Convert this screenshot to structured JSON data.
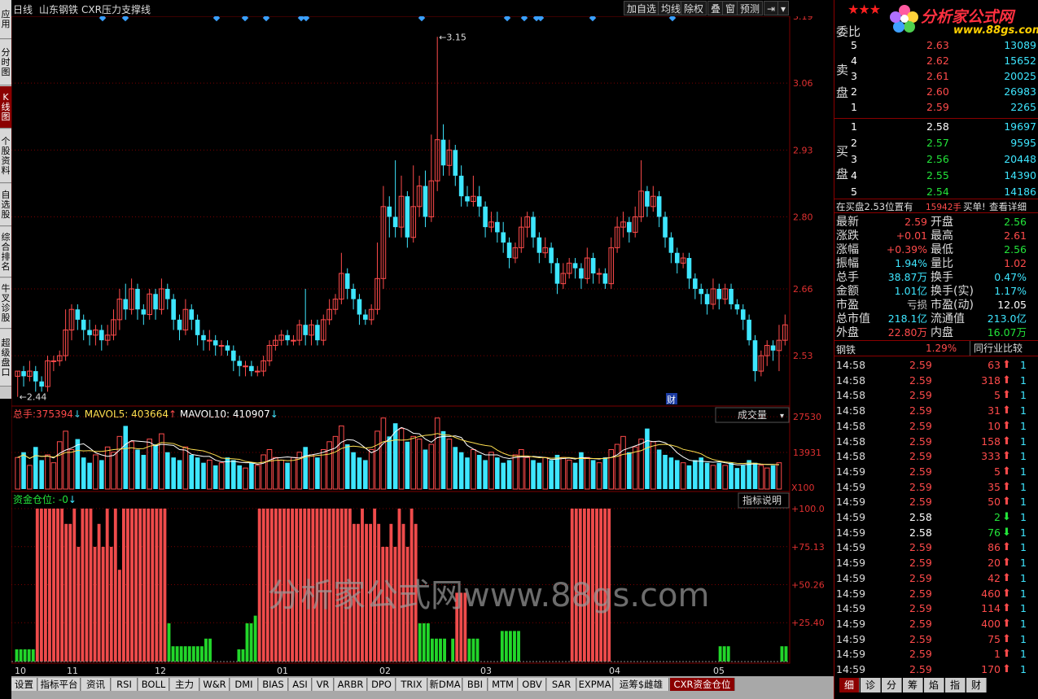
{
  "left_tabs": [
    "应用",
    "分时图",
    "K线图",
    "个股资料",
    "自选股",
    "综合排名",
    "牛叉诊股",
    "超级盘口"
  ],
  "top": {
    "period": "日线",
    "stock": "山东钢铁",
    "indicator": "CXR压力支撑线",
    "buttons": [
      "加自选",
      "均线",
      "除权",
      "叠",
      "窗",
      "预测"
    ],
    "nav_icon": "⇥",
    "menu_icon": "▾"
  },
  "price_axis": [
    "3.19",
    "3.06",
    "2.93",
    "2.80",
    "2.66",
    "2.53"
  ],
  "markers": {
    "high": "3.15",
    "low": "2.44",
    "fin": "财"
  },
  "vol": {
    "total_label": "总手:",
    "total": "375394",
    "ma5_label": "MAVOL5:",
    "ma5": "403664",
    "ma10_label": "MAVOL10:",
    "ma10": "410907",
    "dropdown": "成交量",
    "axis": [
      "27530",
      "13931"
    ],
    "unit": "X100"
  },
  "ind": {
    "label": "资金仓位:",
    "value": "-0",
    "help": "指标说明",
    "axis": [
      "+100.0",
      "+75.13",
      "+50.26",
      "+25.40"
    ]
  },
  "date_axis": [
    "10",
    "11",
    "12",
    "01",
    "02",
    "03",
    "04",
    "05"
  ],
  "watermark": "分析家公式网www.88gs.com",
  "bottom_tabs": [
    "设置",
    "指标平台",
    "资讯",
    "RSI",
    "BOLL",
    "主力",
    "W&R",
    "DMI",
    "BIAS",
    "ASI",
    "VR",
    "ARBR",
    "DPO",
    "TRIX",
    "新DMA",
    "BBI",
    "MTM",
    "OBV",
    "SAR",
    "EXPMA",
    "运筹$雌雄",
    "CXR资金仓位"
  ],
  "colors": {
    "up": "#ff4b4b",
    "down": "#3ee6ff",
    "fund_up": "#ef4b4b",
    "fund_down": "#22d62a",
    "grid": "#7a0000"
  },
  "chart_data": {
    "type": "candlestick",
    "candles": [
      [
        2.49,
        2.5,
        2.45,
        2.5
      ],
      [
        2.5,
        2.49,
        2.47,
        2.51
      ],
      [
        2.49,
        2.5,
        2.48,
        2.52
      ],
      [
        2.5,
        2.48,
        2.46,
        2.51
      ],
      [
        2.48,
        2.47,
        2.46,
        2.49
      ],
      [
        2.47,
        2.52,
        2.46,
        2.53
      ],
      [
        2.52,
        2.52,
        2.5,
        2.53
      ],
      [
        2.52,
        2.53,
        2.51,
        2.54
      ],
      [
        2.53,
        2.58,
        2.52,
        2.62
      ],
      [
        2.58,
        2.62,
        2.56,
        2.63
      ],
      [
        2.62,
        2.6,
        2.58,
        2.63
      ],
      [
        2.6,
        2.58,
        2.56,
        2.61
      ],
      [
        2.58,
        2.57,
        2.55,
        2.6
      ],
      [
        2.57,
        2.58,
        2.55,
        2.59
      ],
      [
        2.58,
        2.56,
        2.54,
        2.59
      ],
      [
        2.56,
        2.57,
        2.55,
        2.59
      ],
      [
        2.57,
        2.6,
        2.56,
        2.62
      ],
      [
        2.6,
        2.64,
        2.58,
        2.66
      ],
      [
        2.64,
        2.62,
        2.6,
        2.67
      ],
      [
        2.62,
        2.66,
        2.61,
        2.68
      ],
      [
        2.66,
        2.62,
        2.6,
        2.67
      ],
      [
        2.62,
        2.61,
        2.59,
        2.63
      ],
      [
        2.61,
        2.65,
        2.6,
        2.66
      ],
      [
        2.65,
        2.62,
        2.6,
        2.66
      ],
      [
        2.62,
        2.66,
        2.61,
        2.68
      ],
      [
        2.66,
        2.64,
        2.62,
        2.67
      ],
      [
        2.64,
        2.6,
        2.58,
        2.65
      ],
      [
        2.6,
        2.58,
        2.56,
        2.61
      ],
      [
        2.58,
        2.62,
        2.57,
        2.64
      ],
      [
        2.62,
        2.6,
        2.58,
        2.63
      ],
      [
        2.6,
        2.57,
        2.55,
        2.61
      ],
      [
        2.57,
        2.56,
        2.54,
        2.58
      ],
      [
        2.56,
        2.56,
        2.54,
        2.58
      ],
      [
        2.56,
        2.55,
        2.53,
        2.57
      ],
      [
        2.55,
        2.55,
        2.53,
        2.56
      ],
      [
        2.55,
        2.54,
        2.53,
        2.56
      ],
      [
        2.54,
        2.52,
        2.5,
        2.55
      ],
      [
        2.52,
        2.51,
        2.49,
        2.53
      ],
      [
        2.51,
        2.51,
        2.49,
        2.52
      ],
      [
        2.51,
        2.5,
        2.49,
        2.52
      ],
      [
        2.5,
        2.5,
        2.49,
        2.51
      ],
      [
        2.5,
        2.52,
        2.49,
        2.53
      ],
      [
        2.52,
        2.55,
        2.51,
        2.56
      ],
      [
        2.55,
        2.56,
        2.54,
        2.57
      ],
      [
        2.56,
        2.57,
        2.55,
        2.58
      ],
      [
        2.57,
        2.56,
        2.55,
        2.58
      ],
      [
        2.56,
        2.56,
        2.55,
        2.57
      ],
      [
        2.56,
        2.59,
        2.55,
        2.6
      ],
      [
        2.59,
        2.57,
        2.55,
        2.66
      ],
      [
        2.57,
        2.59,
        2.55,
        2.6
      ],
      [
        2.59,
        2.56,
        2.55,
        2.6
      ],
      [
        2.56,
        2.6,
        2.55,
        2.61
      ],
      [
        2.6,
        2.62,
        2.59,
        2.64
      ],
      [
        2.62,
        2.64,
        2.61,
        2.65
      ],
      [
        2.64,
        2.69,
        2.63,
        2.73
      ],
      [
        2.69,
        2.66,
        2.64,
        2.7
      ],
      [
        2.66,
        2.64,
        2.62,
        2.67
      ],
      [
        2.64,
        2.61,
        2.59,
        2.65
      ],
      [
        2.61,
        2.6,
        2.59,
        2.62
      ],
      [
        2.6,
        2.62,
        2.59,
        2.63
      ],
      [
        2.62,
        2.68,
        2.61,
        2.75
      ],
      [
        2.68,
        2.82,
        2.66,
        2.86
      ],
      [
        2.82,
        2.8,
        2.76,
        2.84
      ],
      [
        2.8,
        2.78,
        2.76,
        2.91
      ],
      [
        2.78,
        2.84,
        2.76,
        2.88
      ],
      [
        2.84,
        2.76,
        2.74,
        2.85
      ],
      [
        2.76,
        2.82,
        2.75,
        2.9
      ],
      [
        2.82,
        2.86,
        2.8,
        2.88
      ],
      [
        2.86,
        2.8,
        2.78,
        2.89
      ],
      [
        2.8,
        2.87,
        2.79,
        2.96
      ],
      [
        2.87,
        2.95,
        2.85,
        3.15
      ],
      [
        2.95,
        2.9,
        2.88,
        2.98
      ],
      [
        2.9,
        2.93,
        2.88,
        2.95
      ],
      [
        2.93,
        2.88,
        2.86,
        2.94
      ],
      [
        2.88,
        2.84,
        2.82,
        2.9
      ],
      [
        2.84,
        2.83,
        2.82,
        2.86
      ],
      [
        2.83,
        2.84,
        2.82,
        2.88
      ],
      [
        2.84,
        2.82,
        2.8,
        2.86
      ],
      [
        2.82,
        2.78,
        2.76,
        2.83
      ],
      [
        2.78,
        2.79,
        2.77,
        2.81
      ],
      [
        2.79,
        2.77,
        2.75,
        2.81
      ],
      [
        2.77,
        2.75,
        2.73,
        2.79
      ],
      [
        2.75,
        2.72,
        2.7,
        2.76
      ],
      [
        2.72,
        2.74,
        2.71,
        2.75
      ],
      [
        2.74,
        2.78,
        2.73,
        2.8
      ],
      [
        2.78,
        2.8,
        2.76,
        2.81
      ],
      [
        2.8,
        2.76,
        2.74,
        2.81
      ],
      [
        2.76,
        2.73,
        2.71,
        2.77
      ],
      [
        2.73,
        2.74,
        2.72,
        2.76
      ],
      [
        2.74,
        2.71,
        2.69,
        2.75
      ],
      [
        2.71,
        2.67,
        2.65,
        2.72
      ],
      [
        2.67,
        2.69,
        2.66,
        2.71
      ],
      [
        2.69,
        2.71,
        2.68,
        2.72
      ],
      [
        2.71,
        2.7,
        2.68,
        2.72
      ],
      [
        2.7,
        2.68,
        2.66,
        2.71
      ],
      [
        2.68,
        2.72,
        2.67,
        2.74
      ],
      [
        2.72,
        2.69,
        2.67,
        2.73
      ],
      [
        2.69,
        2.69,
        2.67,
        2.7
      ],
      [
        2.69,
        2.67,
        2.66,
        2.7
      ],
      [
        2.67,
        2.74,
        2.66,
        2.76
      ],
      [
        2.74,
        2.78,
        2.73,
        2.8
      ],
      [
        2.78,
        2.79,
        2.76,
        2.81
      ],
      [
        2.79,
        2.77,
        2.75,
        2.8
      ],
      [
        2.77,
        2.8,
        2.76,
        2.82
      ],
      [
        2.8,
        2.85,
        2.79,
        2.91
      ],
      [
        2.85,
        2.82,
        2.8,
        2.86
      ],
      [
        2.82,
        2.84,
        2.81,
        2.86
      ],
      [
        2.84,
        2.8,
        2.78,
        2.85
      ],
      [
        2.8,
        2.76,
        2.74,
        2.81
      ],
      [
        2.76,
        2.73,
        2.71,
        2.77
      ],
      [
        2.73,
        2.71,
        2.69,
        2.74
      ],
      [
        2.71,
        2.72,
        2.7,
        2.73
      ],
      [
        2.72,
        2.68,
        2.66,
        2.73
      ],
      [
        2.68,
        2.66,
        2.64,
        2.69
      ],
      [
        2.66,
        2.65,
        2.63,
        2.67
      ],
      [
        2.65,
        2.63,
        2.61,
        2.66
      ],
      [
        2.63,
        2.66,
        2.62,
        2.68
      ],
      [
        2.66,
        2.64,
        2.62,
        2.67
      ],
      [
        2.64,
        2.66,
        2.63,
        2.67
      ],
      [
        2.66,
        2.63,
        2.62,
        2.67
      ],
      [
        2.63,
        2.62,
        2.61,
        2.64
      ],
      [
        2.62,
        2.6,
        2.58,
        2.63
      ],
      [
        2.6,
        2.56,
        2.55,
        2.61
      ],
      [
        2.56,
        2.5,
        2.48,
        2.57
      ],
      [
        2.5,
        2.53,
        2.49,
        2.54
      ],
      [
        2.53,
        2.55,
        2.51,
        2.56
      ],
      [
        2.55,
        2.54,
        2.52,
        2.56
      ],
      [
        2.54,
        2.56,
        2.5,
        2.59
      ],
      [
        2.56,
        2.59,
        2.55,
        2.61
      ]
    ],
    "volumes": [
      12,
      14,
      9,
      16,
      11,
      13,
      10,
      18,
      22,
      15,
      19,
      12,
      10,
      13,
      11,
      16,
      14,
      20,
      24,
      18,
      15,
      13,
      19,
      17,
      21,
      14,
      12,
      11,
      16,
      13,
      12,
      10,
      11,
      9,
      10,
      12,
      11,
      9,
      8,
      10,
      9,
      13,
      15,
      12,
      11,
      10,
      12,
      14,
      16,
      13,
      12,
      15,
      18,
      20,
      24,
      17,
      14,
      12,
      11,
      15,
      22,
      27,
      20,
      25,
      23,
      18,
      20,
      19,
      15,
      17,
      27,
      22,
      19,
      16,
      14,
      12,
      15,
      13,
      11,
      14,
      12,
      10,
      11,
      13,
      15,
      12,
      11,
      10,
      12,
      11,
      13,
      12,
      11,
      10,
      14,
      12,
      11,
      10,
      12,
      15,
      17,
      20,
      14,
      16,
      19,
      23,
      18,
      15,
      13,
      12,
      11,
      10,
      9,
      11,
      12,
      10,
      9,
      10,
      9,
      10,
      8,
      9,
      11,
      10,
      9,
      8,
      9,
      10
    ],
    "fund": [
      8,
      8,
      8,
      8,
      8,
      100,
      100,
      100,
      100,
      100,
      100,
      100,
      90,
      90,
      100,
      75,
      100,
      100,
      100,
      75,
      90,
      75,
      100,
      75,
      100,
      60,
      100,
      100,
      100,
      100,
      100,
      100,
      100,
      100,
      100,
      100,
      100,
      25,
      10,
      10,
      10,
      10,
      10,
      10,
      10,
      10,
      15,
      15,
      0,
      0,
      0,
      0,
      0,
      0,
      8,
      8,
      25,
      25,
      30,
      100,
      100,
      100,
      100,
      100,
      100,
      100,
      100,
      100,
      100,
      100,
      100,
      100,
      100,
      100,
      100,
      100,
      100,
      100,
      100,
      100,
      100,
      100,
      90,
      90,
      100,
      90,
      90,
      100,
      90,
      75,
      75,
      90,
      75,
      100,
      90,
      75,
      100,
      90,
      25,
      25,
      25,
      15,
      15,
      15,
      15,
      0,
      15,
      45,
      45,
      45,
      15,
      15,
      15,
      0,
      0,
      0,
      0,
      0,
      20,
      20,
      20,
      20,
      20,
      0,
      0,
      0,
      0,
      0,
      0,
      0,
      0,
      0,
      0,
      0,
      0,
      100,
      100,
      100,
      100,
      100,
      100,
      100,
      100,
      100,
      100,
      0,
      0,
      0,
      0,
      0,
      0,
      0,
      0,
      0,
      0,
      0,
      0,
      0,
      0,
      0,
      0,
      0,
      0,
      0,
      0,
      0,
      0,
      0,
      0,
      0,
      0,
      10,
      10,
      10,
      0,
      0,
      0,
      0,
      0,
      0,
      0,
      0,
      0,
      0,
      0,
      0,
      10,
      10
    ],
    "fund_up": [
      0,
      0,
      0,
      0,
      0,
      1,
      1,
      1,
      1,
      1,
      1,
      1,
      1,
      1,
      1,
      1,
      1,
      1,
      1,
      1,
      1,
      1,
      1,
      1,
      1,
      1,
      1,
      1,
      1,
      1,
      1,
      1,
      1,
      1,
      1,
      1,
      1,
      0,
      0,
      0,
      0,
      0,
      0,
      0,
      0,
      0,
      0,
      0,
      0,
      0,
      0,
      0,
      0,
      0,
      0,
      0,
      0,
      0,
      0,
      1,
      1,
      1,
      1,
      1,
      1,
      1,
      1,
      1,
      1,
      1,
      1,
      1,
      1,
      1,
      1,
      1,
      1,
      1,
      1,
      1,
      1,
      1,
      1,
      1,
      1,
      1,
      1,
      1,
      1,
      1,
      1,
      1,
      1,
      1,
      1,
      1,
      1,
      1,
      0,
      0,
      0,
      0,
      0,
      0,
      0,
      0,
      0,
      1,
      1,
      1,
      0,
      0,
      0,
      0,
      0,
      0,
      0,
      0,
      0,
      0,
      0,
      0,
      0,
      0,
      0,
      0,
      0,
      0,
      0,
      0,
      0,
      0,
      0,
      0,
      0,
      1,
      1,
      1,
      1,
      1,
      1,
      1,
      1,
      1,
      1,
      0,
      0,
      0,
      0,
      0,
      0,
      0,
      0,
      0,
      0,
      0,
      0,
      0,
      0,
      0,
      0,
      0,
      0,
      0,
      0,
      0,
      0,
      0,
      0,
      0,
      0,
      0,
      0,
      0,
      0,
      0,
      0,
      0,
      0,
      0,
      0,
      0,
      0,
      0,
      0,
      0,
      0,
      0
    ],
    "xlabels": [
      "10",
      "11",
      "12",
      "01",
      "02",
      "03",
      "04",
      "05"
    ],
    "ylim": [
      2.44,
      3.19
    ]
  },
  "right": {
    "weibi": "委比",
    "sell_label": [
      "卖",
      "盘"
    ],
    "buy_label": [
      "买",
      "盘"
    ],
    "asks": [
      [
        "5",
        "2.63",
        "13089"
      ],
      [
        "4",
        "2.62",
        "15652"
      ],
      [
        "3",
        "2.61",
        "20025"
      ],
      [
        "2",
        "2.60",
        "26983"
      ],
      [
        "1",
        "2.59",
        "2265"
      ]
    ],
    "bids": [
      [
        "1",
        "2.58",
        "19697"
      ],
      [
        "2",
        "2.57",
        "9595"
      ],
      [
        "3",
        "2.56",
        "20448"
      ],
      [
        "4",
        "2.55",
        "14390"
      ],
      [
        "5",
        "2.54",
        "14186"
      ]
    ],
    "notice": {
      "a": "在买盘2.53位置有",
      "b": "15942手",
      "c": "买单!",
      "d": "查看详细"
    },
    "stats": [
      [
        "最新",
        "2.59",
        "red",
        "开盘",
        "2.56",
        "grn"
      ],
      [
        "涨跌",
        "+0.01",
        "red",
        "最高",
        "2.61",
        "red"
      ],
      [
        "涨幅",
        "+0.39%",
        "red",
        "最低",
        "2.56",
        "grn"
      ],
      [
        "振幅",
        "1.94%",
        "cyan",
        "量比",
        "1.02",
        "red"
      ],
      [
        "总手",
        "38.87万",
        "cyan",
        "换手",
        "0.47%",
        "cyan"
      ],
      [
        "金额",
        "1.01亿",
        "cyan",
        "换手(实)",
        "1.17%",
        "cyan"
      ],
      [
        "市盈",
        "亏损",
        "gry",
        "市盈(动)",
        "12.05",
        "wht"
      ],
      [
        "总市值",
        "218.1亿",
        "cyan",
        "流通值",
        "213.0亿",
        "cyan"
      ],
      [
        "外盘",
        "22.80万",
        "red",
        "内盘",
        "16.07万",
        "grn"
      ]
    ],
    "industry": {
      "name": "钢铁",
      "pct": "1.29%",
      "compare": "同行业比较"
    },
    "ticks": [
      [
        "14:58",
        "2.59",
        "63",
        "up",
        "1"
      ],
      [
        "14:58",
        "2.59",
        "318",
        "up",
        "1"
      ],
      [
        "14:58",
        "2.59",
        "5",
        "up",
        "1"
      ],
      [
        "14:58",
        "2.59",
        "31",
        "up",
        "1"
      ],
      [
        "14:58",
        "2.59",
        "10",
        "up",
        "1"
      ],
      [
        "14:58",
        "2.59",
        "158",
        "up",
        "1"
      ],
      [
        "14:58",
        "2.59",
        "333",
        "up",
        "1"
      ],
      [
        "14:59",
        "2.59",
        "5",
        "up",
        "1"
      ],
      [
        "14:59",
        "2.59",
        "35",
        "up",
        "1"
      ],
      [
        "14:59",
        "2.59",
        "50",
        "up",
        "1"
      ],
      [
        "14:59",
        "2.58",
        "2",
        "dn",
        "1"
      ],
      [
        "14:59",
        "2.58",
        "76",
        "dn",
        "1"
      ],
      [
        "14:59",
        "2.59",
        "86",
        "up",
        "1"
      ],
      [
        "14:59",
        "2.59",
        "20",
        "up",
        "1"
      ],
      [
        "14:59",
        "2.59",
        "42",
        "up",
        "1"
      ],
      [
        "14:59",
        "2.59",
        "460",
        "up",
        "1"
      ],
      [
        "14:59",
        "2.59",
        "114",
        "up",
        "1"
      ],
      [
        "14:59",
        "2.59",
        "400",
        "up",
        "1"
      ],
      [
        "14:59",
        "2.59",
        "75",
        "up",
        "1"
      ],
      [
        "14:59",
        "2.59",
        "1",
        "up",
        "1"
      ],
      [
        "14:59",
        "2.59",
        "170",
        "up",
        "1"
      ]
    ],
    "bottom_tabs": [
      "细",
      "诊",
      "分",
      "筹",
      "焰",
      "指",
      "财"
    ],
    "logo": {
      "text": "分析家公式网",
      "url": "www.88gs.com"
    }
  }
}
